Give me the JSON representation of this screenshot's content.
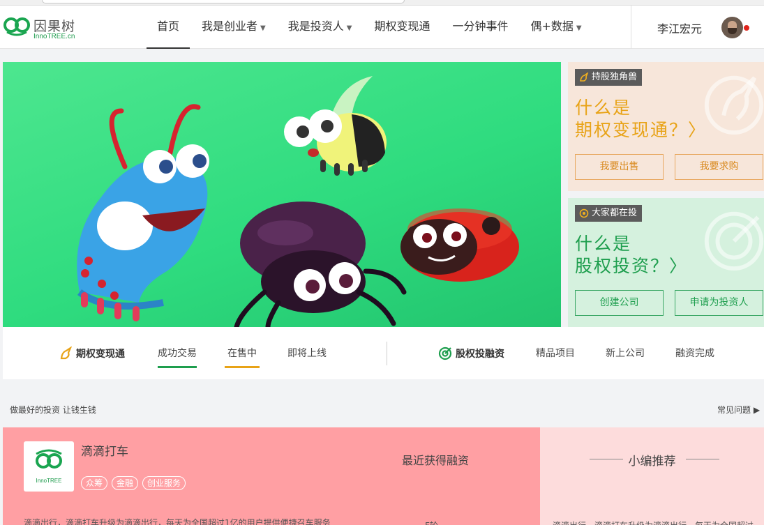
{
  "brand": {
    "name_cn": "因果树",
    "name_en": "InnoTREE.cn"
  },
  "nav": {
    "items": [
      {
        "label": "首页",
        "has_caret": false,
        "active": true
      },
      {
        "label": "我是创业者",
        "has_caret": true,
        "active": false
      },
      {
        "label": "我是投资人",
        "has_caret": true,
        "active": false
      },
      {
        "label": "期权变现通",
        "has_caret": false,
        "active": false
      },
      {
        "label": "一分钟事件",
        "has_caret": false,
        "active": false
      },
      {
        "label": "偶+数据",
        "has_caret": true,
        "active": false
      }
    ],
    "caret": "▼"
  },
  "user": {
    "name": "李江宏元",
    "has_notification": true
  },
  "cards": {
    "unicorn": {
      "tag": "持股独角兽",
      "title_line1": "什么是",
      "title_line2": "期权变现通？〉",
      "btn_left": "我要出售",
      "btn_right": "我要求购"
    },
    "invest": {
      "tag": "大家都在投",
      "title_line1": "什么是",
      "title_line2": "股权投资？〉",
      "btn_left": "创建公司",
      "btn_right": "申请为投资人"
    }
  },
  "tabs": {
    "options_section": {
      "title": "期权变现通",
      "items": [
        "成功交易",
        "在售中",
        "即将上线"
      ]
    },
    "equity_section": {
      "title": "股权投融资",
      "items": [
        "精品项目",
        "新上公司",
        "融资完成"
      ]
    }
  },
  "strip": {
    "slogan": "做最好的投资 让钱生钱",
    "faq": "常见问题 ▶"
  },
  "feature": {
    "company_name": "滴滴打车",
    "logo_text": "InnoTREE",
    "tags": [
      "众筹",
      "金融",
      "创业服务"
    ],
    "funding_label": "最近获得融资",
    "description": "滴滴出行，滴滴打车升级为滴滴出行，每天为全国超过1亿的用户提供便捷召车服务",
    "round": "F轮"
  },
  "editor": {
    "title": "小编推荐",
    "description": "滴滴出行，滴滴打车升级为滴滴出行，每天为全国超过"
  },
  "colors": {
    "brand_green": "#1e9e4e",
    "accent_orange": "#e8a317",
    "hero_bg": "#3ee08a",
    "feature_bg": "#ff9fa3"
  }
}
